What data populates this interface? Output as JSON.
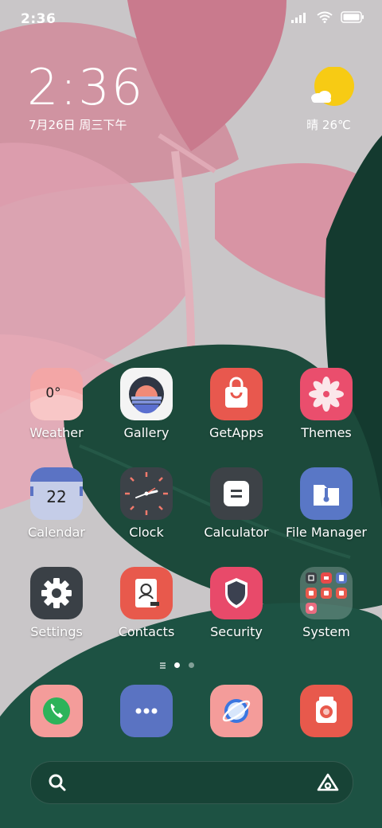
{
  "status_bar": {
    "time": "2:36",
    "icons": [
      "signal-icon",
      "wifi-icon",
      "battery-icon"
    ]
  },
  "clock_widget": {
    "time": "2:36",
    "date": "7月26日 周三下午"
  },
  "weather_widget": {
    "text": "晴 26℃",
    "icon": "sun-cloud-icon"
  },
  "apps": [
    {
      "label": "Weather",
      "icon": "weather-icon",
      "temp": "0°"
    },
    {
      "label": "Gallery",
      "icon": "gallery-icon"
    },
    {
      "label": "GetApps",
      "icon": "shopping-bag-icon"
    },
    {
      "label": "Themes",
      "icon": "flower-icon"
    },
    {
      "label": "Calendar",
      "icon": "calendar-icon",
      "day": "22"
    },
    {
      "label": "Clock",
      "icon": "clock-icon"
    },
    {
      "label": "Calculator",
      "icon": "calculator-icon"
    },
    {
      "label": "File Manager",
      "icon": "folder-icon"
    },
    {
      "label": "Settings",
      "icon": "gear-icon"
    },
    {
      "label": "Contacts",
      "icon": "contacts-icon"
    },
    {
      "label": "Security",
      "icon": "shield-icon"
    },
    {
      "label": "System",
      "icon": "folder-grid-icon"
    }
  ],
  "page_indicator": {
    "pages": 2,
    "current": 1
  },
  "dock": [
    {
      "name": "phone",
      "icon": "phone-icon"
    },
    {
      "name": "messaging",
      "icon": "chat-dots-icon"
    },
    {
      "name": "browser",
      "icon": "planet-icon"
    },
    {
      "name": "camera",
      "icon": "camera-icon"
    }
  ],
  "search_bar": {
    "left_icon": "search-icon",
    "right_icon": "assistant-icon"
  },
  "colors": {
    "weather_bg": "#f3a6a6",
    "gallery_bg": "#f4f4f4",
    "getapps_bg": "#e8584e",
    "themes_bg": "#ea4e6d",
    "calendar_bg": "#5b73c4",
    "clock_bg": "#3c4248",
    "calculator_bg": "#3d4247",
    "filemanager_bg": "#5977c6",
    "settings_bg": "#3a4046",
    "contacts_bg": "#e8594c",
    "security_bg": "#e84a6a",
    "phone_bg": "#f49c9a",
    "messaging_bg": "#5a73c2",
    "browser_bg": "#f49c9a",
    "camera_bg": "#e8594c"
  }
}
